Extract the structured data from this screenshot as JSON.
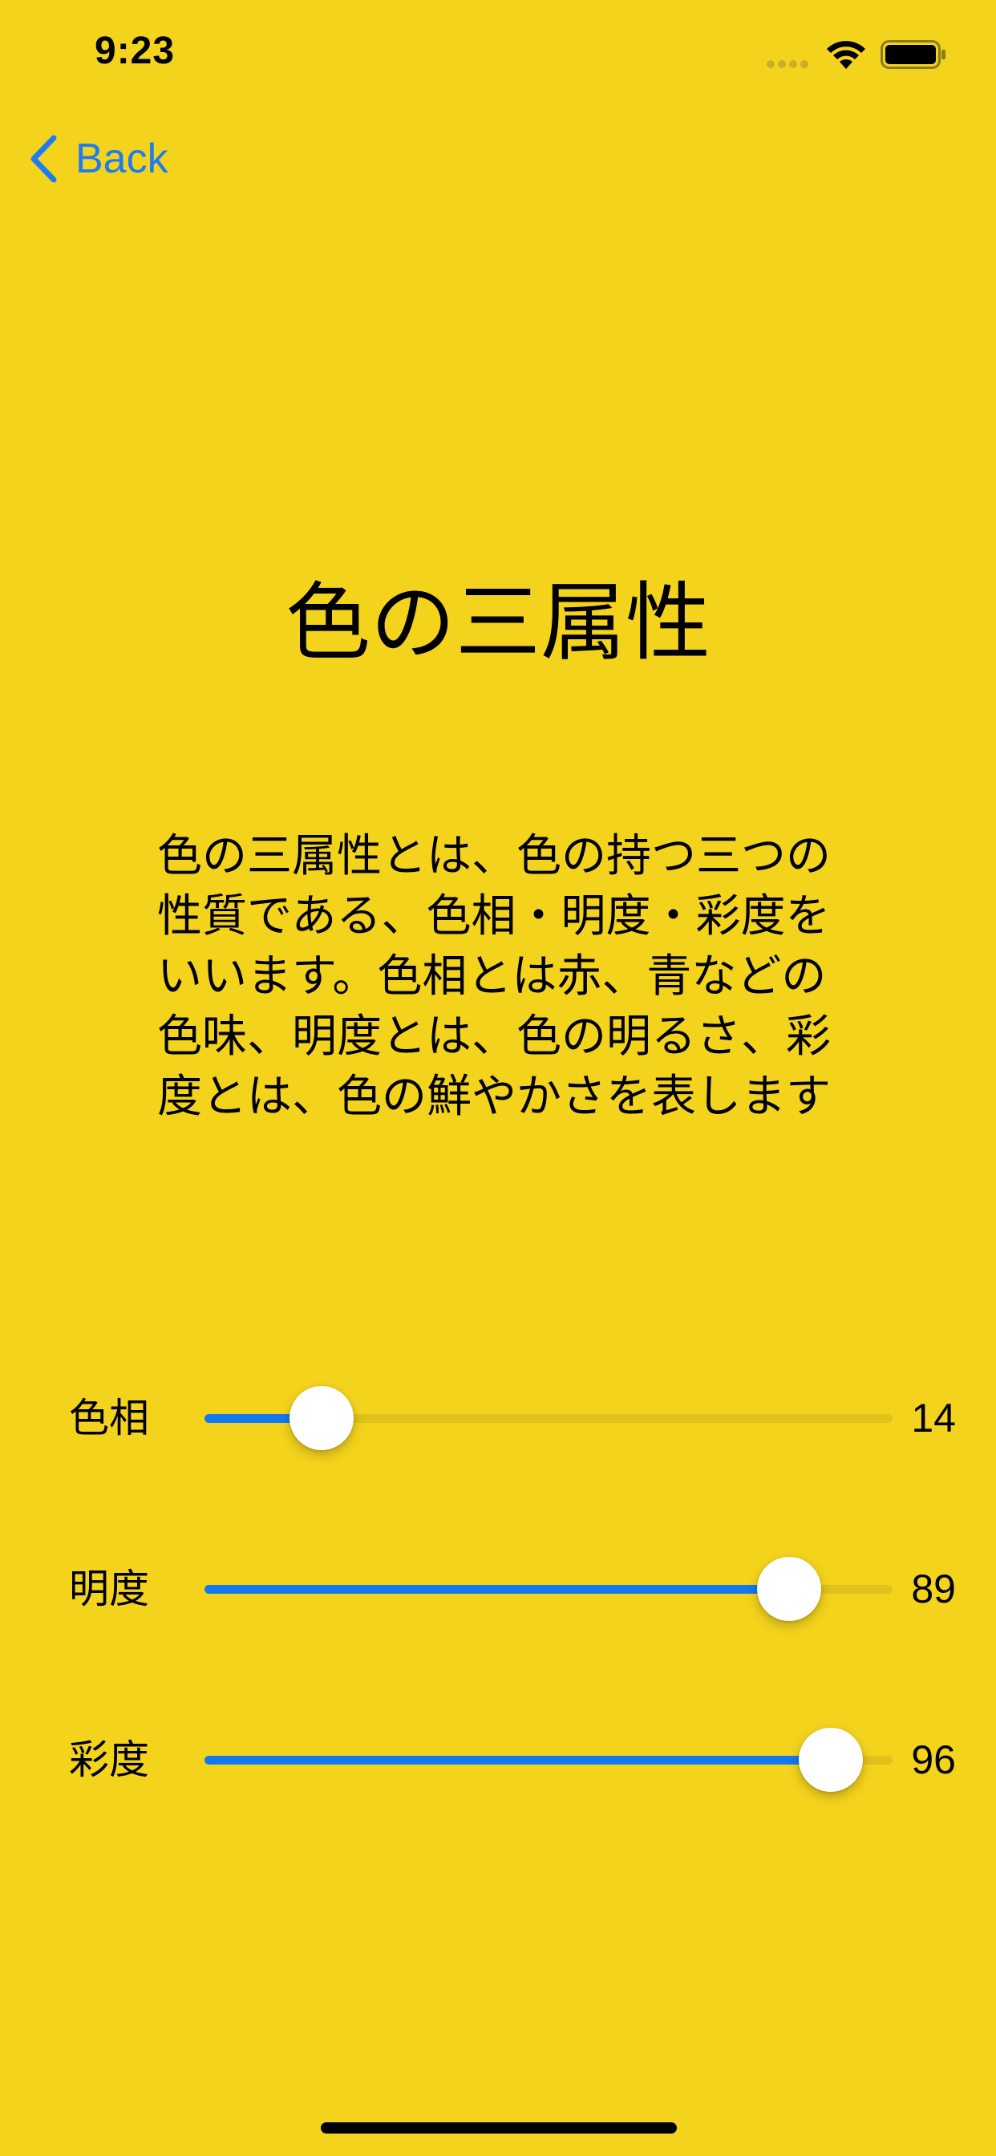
{
  "status_bar": {
    "time": "9:23"
  },
  "nav": {
    "back_label": "Back"
  },
  "page": {
    "title": "色の三属性",
    "description": "色の三属性とは、色の持つ三つの性質である、色相・明度・彩度をいいます。色相とは赤、青などの色味、明度とは、色の明るさ、彩度とは、色の鮮やかさを表します"
  },
  "sliders": [
    {
      "label": "色相",
      "value": "14",
      "fraction": 0.17
    },
    {
      "label": "明度",
      "value": "89",
      "fraction": 0.85
    },
    {
      "label": "彩度",
      "value": "96",
      "fraction": 0.91
    }
  ],
  "colors": {
    "background": "#F4D31D",
    "accent": "#1479F0",
    "track": "#E1C11B",
    "text": "#000000"
  }
}
